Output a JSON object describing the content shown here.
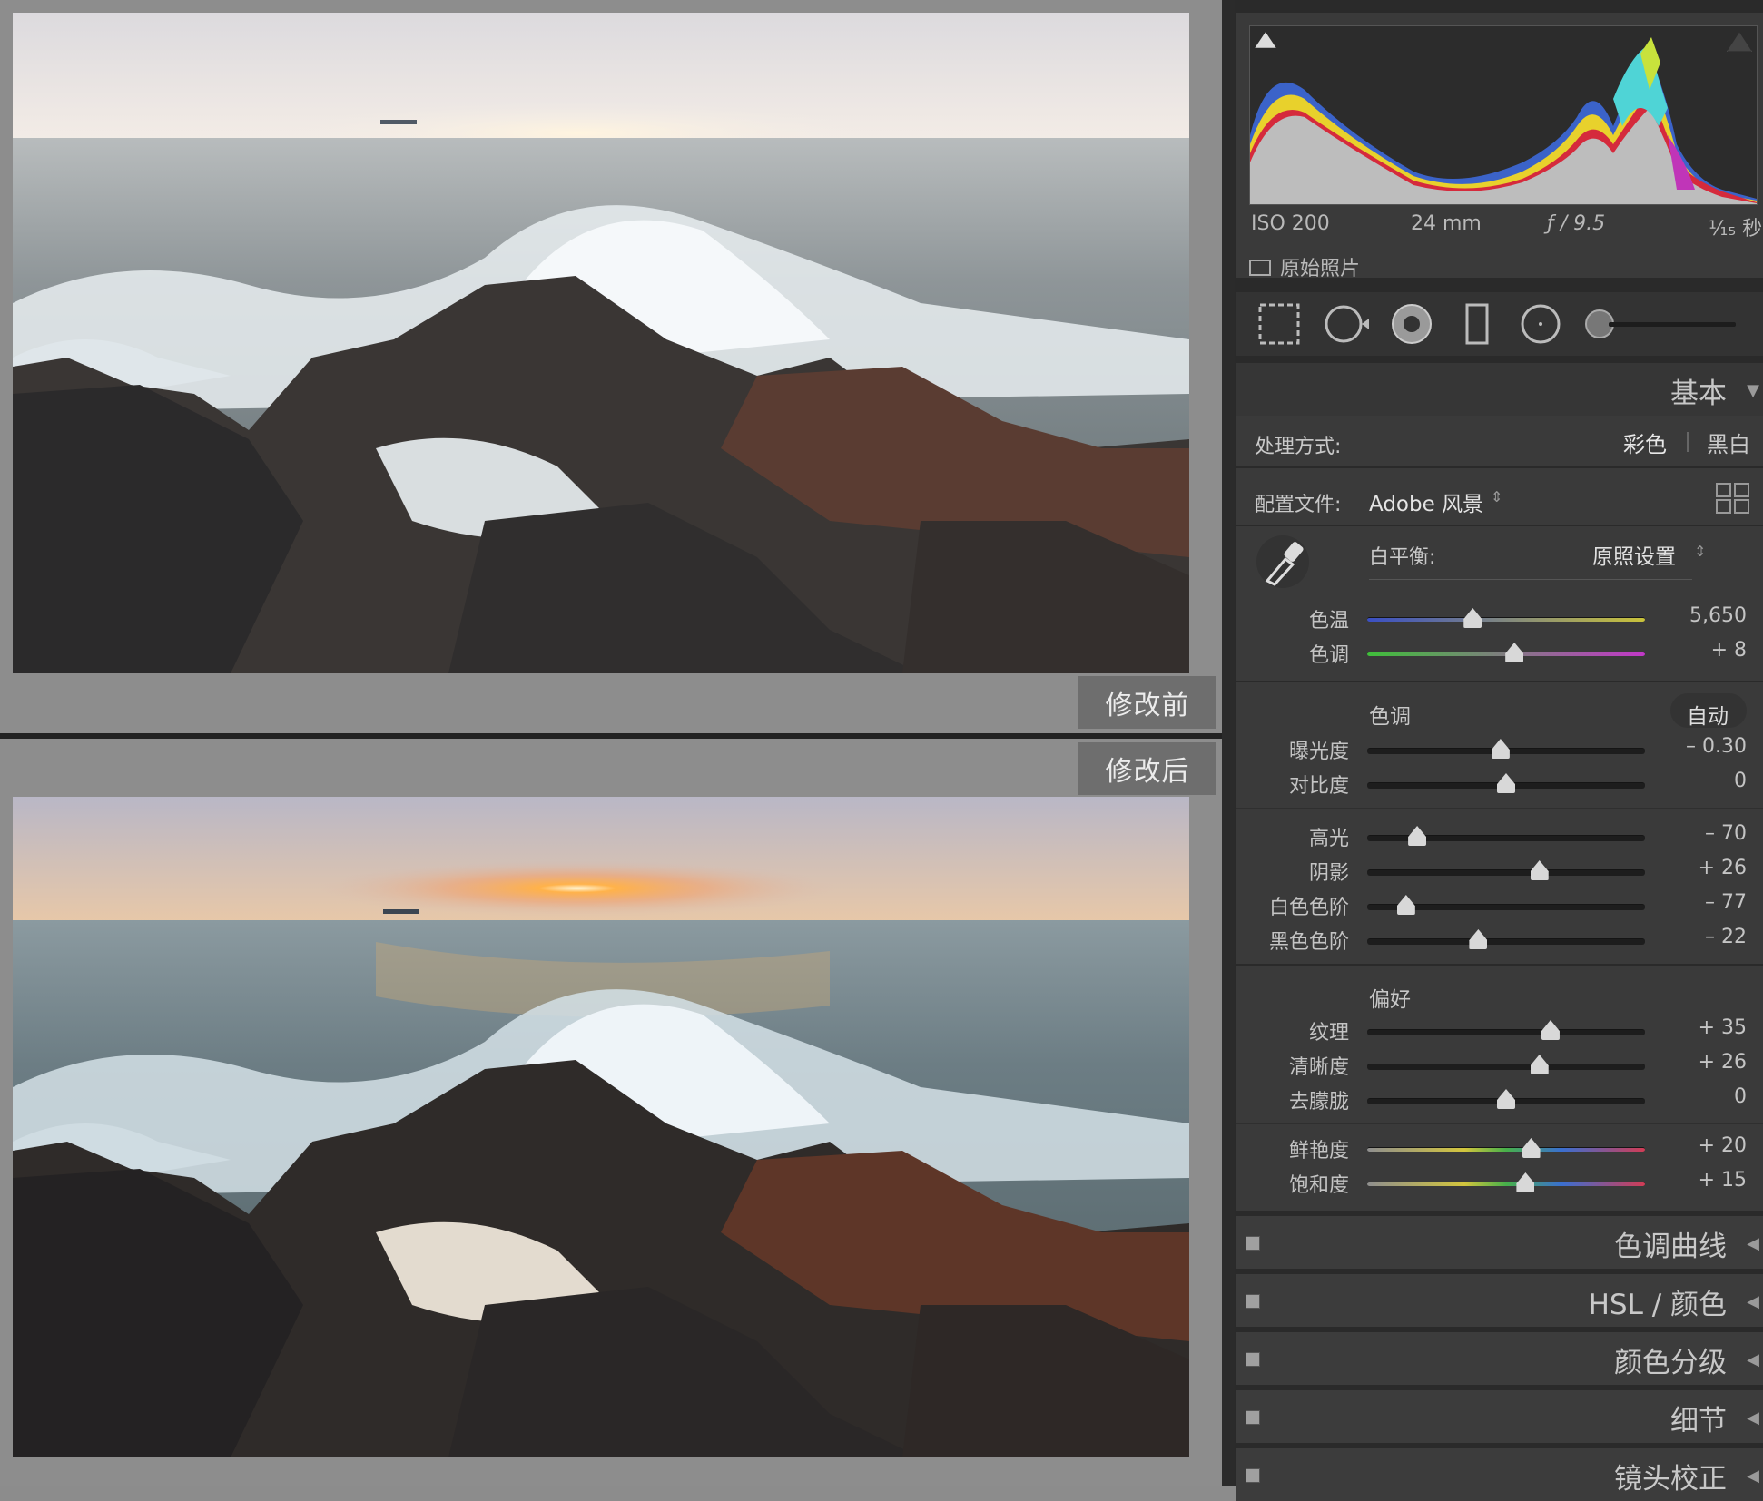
{
  "compare": {
    "before_label": "修改前",
    "after_label": "修改后"
  },
  "histogram": {
    "iso": "ISO 200",
    "focal": "24 mm",
    "aperture": "ƒ / 9.5",
    "shutter": "⅟₁₅ 秒",
    "original_label": "原始照片"
  },
  "basic": {
    "title": "基本",
    "treatment_label": "处理方式:",
    "treatment_color": "彩色",
    "treatment_bw": "黑白",
    "profile_label": "配置文件:",
    "profile_value": "Adobe 风景",
    "wb_label": "白平衡:",
    "wb_value": "原照设置",
    "tone_title": "色调",
    "auto_label": "自动",
    "presence_title": "偏好"
  },
  "sliders": [
    {
      "label": "色温",
      "value": "5,650",
      "pos": 0.38,
      "track": "temp"
    },
    {
      "label": "色调",
      "value": "+ 8",
      "pos": 0.53,
      "track": "tint"
    },
    {
      "label": "曝光度",
      "value": "– 0.30",
      "pos": 0.48,
      "track": "gray"
    },
    {
      "label": "对比度",
      "value": "0",
      "pos": 0.5,
      "track": "gray"
    },
    {
      "label": "高光",
      "value": "– 70",
      "pos": 0.18,
      "track": "gray"
    },
    {
      "label": "阴影",
      "value": "+ 26",
      "pos": 0.62,
      "track": "gray"
    },
    {
      "label": "白色色阶",
      "value": "– 77",
      "pos": 0.14,
      "track": "gray"
    },
    {
      "label": "黑色色阶",
      "value": "– 22",
      "pos": 0.4,
      "track": "gray"
    },
    {
      "label": "纹理",
      "value": "+ 35",
      "pos": 0.66,
      "track": "gray"
    },
    {
      "label": "清晰度",
      "value": "+ 26",
      "pos": 0.62,
      "track": "gray"
    },
    {
      "label": "去朦胧",
      "value": "0",
      "pos": 0.5,
      "track": "gray"
    },
    {
      "label": "鲜艳度",
      "value": "+ 20",
      "pos": 0.59,
      "track": "vib"
    },
    {
      "label": "饱和度",
      "value": "+ 15",
      "pos": 0.57,
      "track": "vib"
    }
  ],
  "panels": [
    {
      "title": "色调曲线"
    },
    {
      "title": "HSL / 颜色"
    },
    {
      "title": "颜色分级"
    },
    {
      "title": "细节"
    },
    {
      "title": "镜头校正"
    }
  ],
  "colors": {
    "panel_bg": "#3a3a3a",
    "accent_label": "#6e6e6e"
  }
}
